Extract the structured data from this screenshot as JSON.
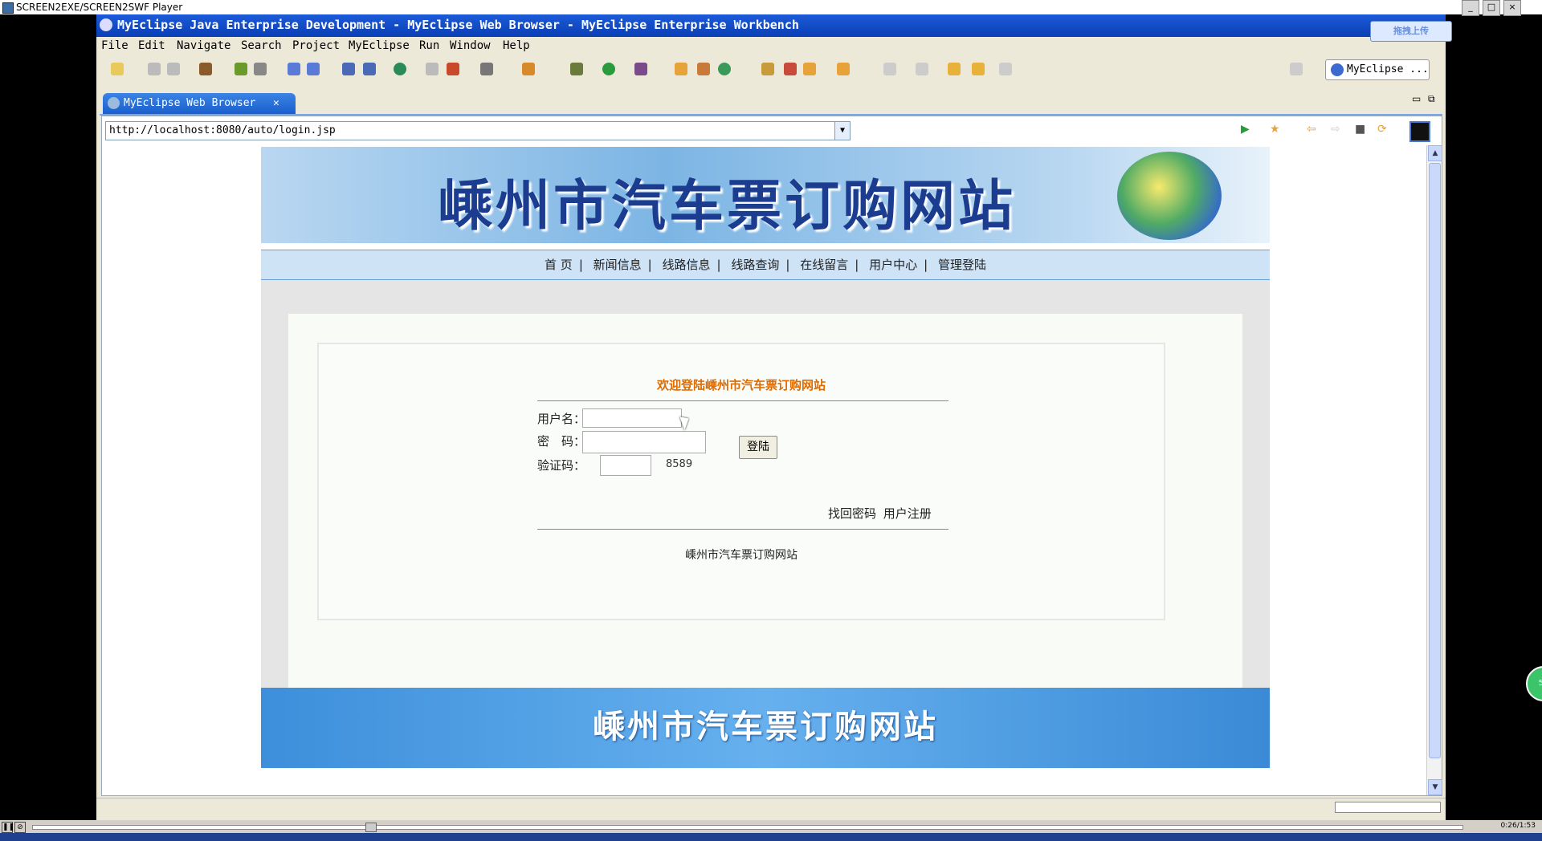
{
  "player": {
    "title": "SCREEN2EXE/SCREEN2SWF Player",
    "time": "0:26/1:53"
  },
  "window": {
    "title": "MyEclipse Java Enterprise Development - MyEclipse Web Browser - MyEclipse Enterprise Workbench",
    "upload_label": "拖拽上传"
  },
  "menu": [
    "File",
    "Edit",
    "Navigate",
    "Search",
    "Project",
    "MyEclipse",
    "Run",
    "Window",
    "Help"
  ],
  "perspective": {
    "label": "MyEclipse ..."
  },
  "editor_tab": {
    "label": "MyEclipse Web Browser"
  },
  "browser": {
    "url": "http://localhost:8080/auto/login.jsp"
  },
  "site": {
    "banner_title": "嵊州市汽车票订购网站",
    "nav": [
      "首 页",
      "新闻信息",
      "线路信息",
      "线路查询",
      "在线留言",
      "用户中心",
      "管理登陆"
    ],
    "welcome": "欢迎登陆嵊州市汽车票订购网站",
    "form": {
      "username_label": "用户名：",
      "password_label": "密　码：",
      "captcha_label": "验证码：",
      "captcha_code": "8589",
      "username_value": "",
      "password_value": "",
      "captcha_value": "",
      "login_button": "登陆"
    },
    "links": {
      "forgot": "找回密码",
      "register": "用户注册"
    },
    "footer_text": "嵊州市汽车票订购网站",
    "footer_banner": "嵊州市汽车票订购网站"
  }
}
